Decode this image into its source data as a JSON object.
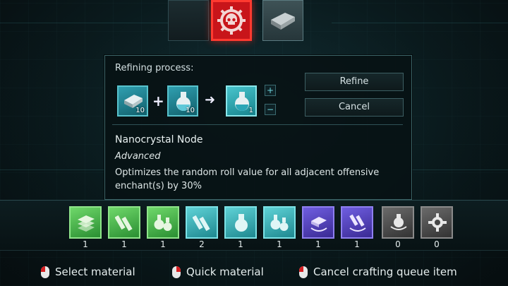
{
  "top_tabs": [
    {
      "name": "blank",
      "icon": "empty-slot-icon",
      "active": false
    },
    {
      "name": "skull-gear",
      "icon": "skull-gear-icon",
      "active": true
    },
    {
      "name": "ingot",
      "icon": "ingot-icon",
      "active": false
    }
  ],
  "panel": {
    "title": "Refining process:",
    "inputs": [
      {
        "icon": "ingot-icon",
        "qty": "10"
      },
      {
        "icon": "flask-icon",
        "qty": "10"
      }
    ],
    "output": {
      "icon": "flask-icon",
      "qty": "1"
    },
    "plus_symbol": "+",
    "arrow_symbol": "➜",
    "increment_label": "+",
    "decrement_label": "−",
    "refine_label": "Refine",
    "cancel_label": "Cancel",
    "item_name": "Nanocrystal Node",
    "item_tier": "Advanced",
    "item_description": "Optimizes the random roll value for all adjacent offensive enchant(s) by 30%"
  },
  "inventory": [
    {
      "color": "green",
      "icon": "ingot-stack-icon",
      "count": "1"
    },
    {
      "color": "green",
      "icon": "bolts-icon",
      "count": "1"
    },
    {
      "color": "green",
      "icon": "flasks-icon",
      "count": "1"
    },
    {
      "color": "teal",
      "icon": "bolts-icon",
      "count": "2"
    },
    {
      "color": "teal",
      "icon": "flask-icon",
      "count": "1"
    },
    {
      "color": "teal",
      "icon": "flasks-icon",
      "count": "1"
    },
    {
      "color": "purple",
      "icon": "ingot-wreath-icon",
      "count": "1"
    },
    {
      "color": "purple",
      "icon": "bolts-wreath-icon",
      "count": "1"
    },
    {
      "color": "grey",
      "icon": "flask-wreath-icon",
      "count": "0"
    },
    {
      "color": "grey",
      "icon": "gear-emblem-icon",
      "count": "0"
    }
  ],
  "hints": [
    {
      "mouse_button": "left",
      "label": "Select material"
    },
    {
      "mouse_button": "right",
      "label": "Quick material"
    },
    {
      "mouse_button": "left",
      "label": "Cancel crafting queue item"
    }
  ],
  "colors": {
    "accent_red": "#c8151a",
    "accent_teal": "#58c2cc",
    "panel_border": "#3c6468"
  }
}
